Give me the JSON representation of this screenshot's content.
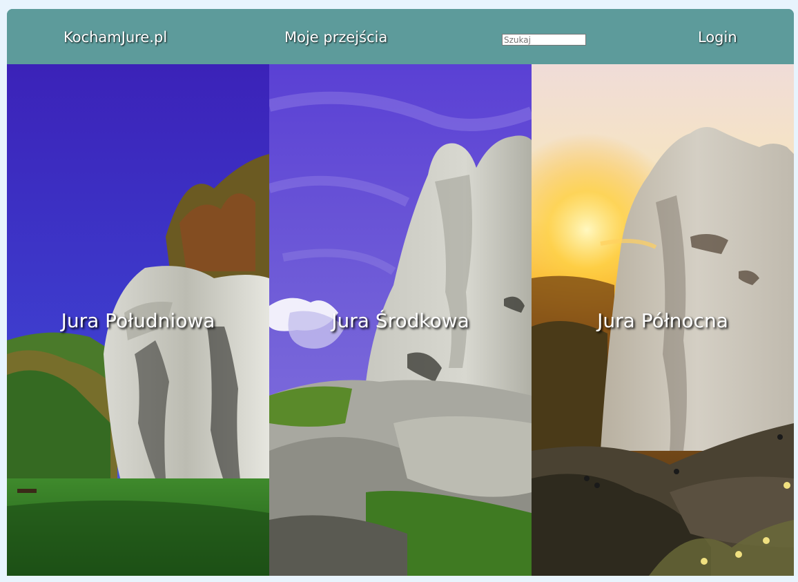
{
  "navbar": {
    "brand": "KochamJure.pl",
    "my_passes": "Moje przejścia",
    "search_placeholder": "Szukaj",
    "login": "Login",
    "background": "#5d9b9b"
  },
  "regions": [
    {
      "label": "Jura Południowa",
      "photo": "limestone-rock-blue-sky-meadow"
    },
    {
      "label": "Jura Środkowa",
      "photo": "limestone-tower-purple-sky"
    },
    {
      "label": "Jura Północna",
      "photo": "limestone-rock-sunset-climbers"
    }
  ]
}
